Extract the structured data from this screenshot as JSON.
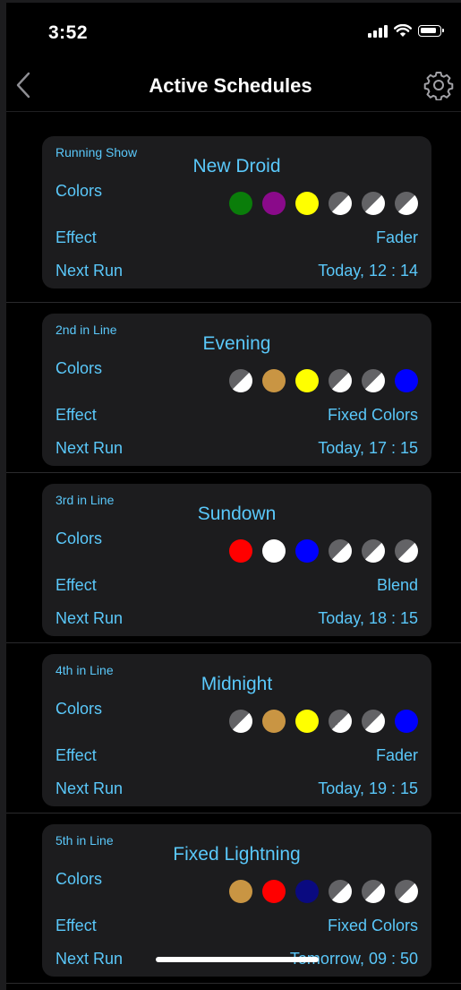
{
  "status_bar": {
    "time": "3:52"
  },
  "nav": {
    "title": "Active Schedules",
    "back_icon": "chevron-left-icon",
    "settings_icon": "gear-icon"
  },
  "labels": {
    "colors": "Colors",
    "effect": "Effect",
    "next_run": "Next Run"
  },
  "schedules": [
    {
      "rank": "Running Show",
      "name": "New Droid",
      "effect": "Fader",
      "next_run": "Today, 12 : 14",
      "colors": [
        "#0a7d0a",
        "#8a0a8a",
        "#ffff00",
        "unset",
        "unset",
        "unset"
      ]
    },
    {
      "rank": "2nd in Line",
      "name": "Evening",
      "effect": "Fixed Colors",
      "next_run": "Today, 17 : 15",
      "colors": [
        "unset",
        "#c99543",
        "#ffff00",
        "unset",
        "unset",
        "#0000ff"
      ]
    },
    {
      "rank": "3rd in Line",
      "name": "Sundown",
      "effect": "Blend",
      "next_run": "Today, 18 : 15",
      "colors": [
        "#ff0000",
        "#ffffff",
        "#0000ff",
        "unset",
        "unset",
        "unset"
      ]
    },
    {
      "rank": "4th in Line",
      "name": "Midnight",
      "effect": "Fader",
      "next_run": "Today, 19 : 15",
      "colors": [
        "unset",
        "#c99543",
        "#ffff00",
        "unset",
        "unset",
        "#0000ff"
      ]
    },
    {
      "rank": "5th in Line",
      "name": "Fixed Lightning",
      "effect": "Fixed Colors",
      "next_run": "Tomorrow, 09 : 50",
      "colors": [
        "#c99543",
        "#ff0000",
        "#0a0a80",
        "unset",
        "unset",
        "unset"
      ]
    }
  ]
}
